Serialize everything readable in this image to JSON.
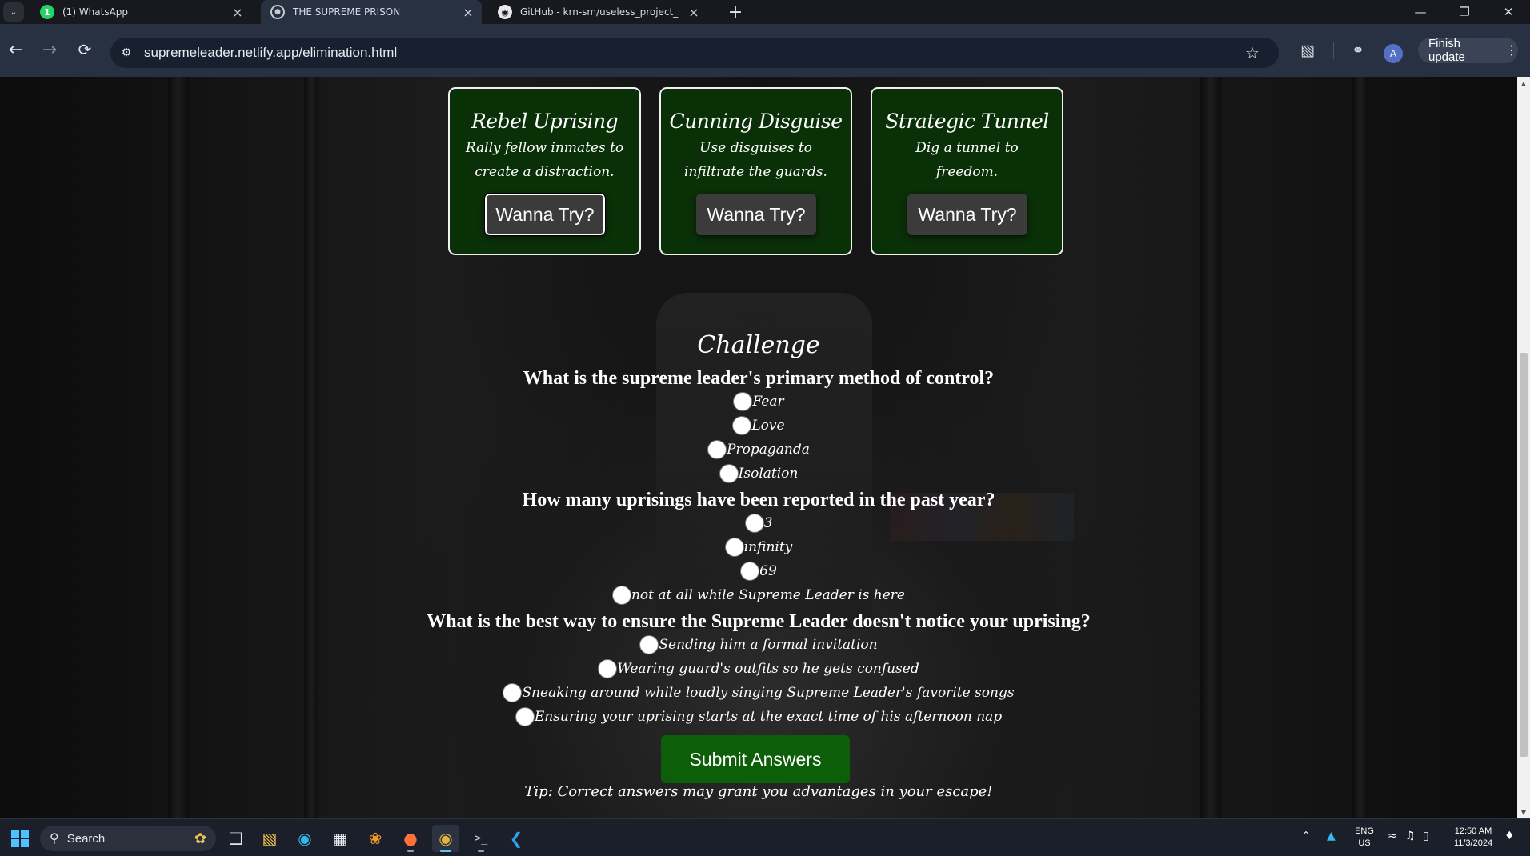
{
  "browser": {
    "tabs": [
      {
        "label": "(1) WhatsApp",
        "favicon": "whatsapp-icon",
        "active": false
      },
      {
        "label": "THE SUPREME PRISON",
        "favicon": "globe-icon",
        "active": true
      },
      {
        "label": "GitHub - krn-sm/useless_project_temp",
        "favicon": "github-icon",
        "active": false
      }
    ],
    "whatsapp_badge": "1",
    "url": "supremeleader.netlify.app/elimination.html",
    "profile_initial": "A",
    "finish_update_label": "Finish update"
  },
  "colors": {
    "card_bg": "#0a3008",
    "submit_bg": "#0c5f08",
    "try_button_bg": "#3b3b3b",
    "chrome_bg": "#283142"
  },
  "cards": [
    {
      "title": "Rebel Uprising",
      "description": "Rally fellow inmates to create a distraction.",
      "button": "Wanna Try?"
    },
    {
      "title": "Cunning Disguise",
      "description": "Use disguises to infiltrate the guards.",
      "button": "Wanna Try?"
    },
    {
      "title": "Strategic Tunnel",
      "description": "Dig a tunnel to freedom.",
      "button": "Wanna Try?"
    }
  ],
  "challenge": {
    "title": "Challenge",
    "questions": [
      {
        "text": "What is the supreme leader's primary method of control?",
        "options": [
          "Fear",
          "Love",
          "Propaganda",
          "Isolation"
        ]
      },
      {
        "text": "How many uprisings have been reported in the past year?",
        "options": [
          "3",
          "infinity",
          "69",
          "not at all while Supreme Leader is here"
        ]
      },
      {
        "text": "What is the best way to ensure the Supreme Leader doesn't notice your uprising?",
        "options": [
          "Sending him a formal invitation",
          "Wearing guard's outfits so he gets confused",
          "Sneaking around while loudly singing Supreme Leader's favorite songs",
          "Ensuring your uprising starts at the exact time of his afternoon nap"
        ]
      }
    ],
    "submit_label": "Submit Answers",
    "tip": "Tip: Correct answers may grant you advantages in your escape!"
  },
  "taskbar": {
    "search_label": "Search",
    "language_line1": "ENG",
    "language_line2": "US",
    "time": "12:50 AM",
    "date": "11/3/2024"
  }
}
